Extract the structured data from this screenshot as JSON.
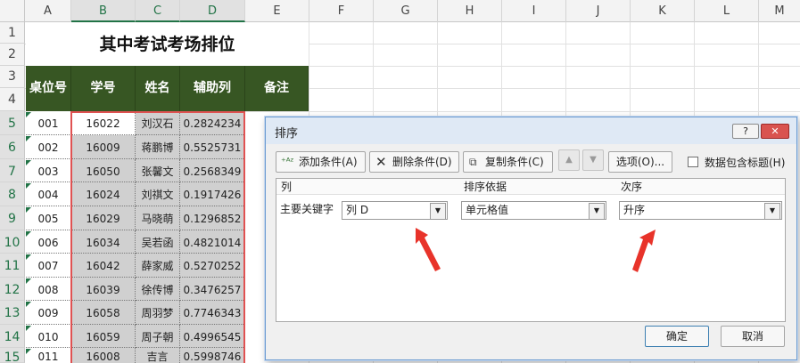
{
  "columns": [
    "A",
    "B",
    "C",
    "D",
    "E",
    "F",
    "G",
    "H",
    "I",
    "J",
    "K",
    "L",
    "M"
  ],
  "rows": [
    "1",
    "2",
    "3",
    "4",
    "5",
    "6",
    "7",
    "8",
    "9",
    "10",
    "11",
    "12",
    "13",
    "14",
    "15"
  ],
  "sheet": {
    "title": "其中考试考场排位",
    "headers": [
      "桌位号",
      "学号",
      "姓名",
      "辅助列",
      "备注"
    ],
    "data_rows": [
      {
        "seat": "001",
        "id": "16022",
        "name": "刘汉石",
        "aux": "0.2824234"
      },
      {
        "seat": "002",
        "id": "16009",
        "name": "蒋鹏博",
        "aux": "0.5525731"
      },
      {
        "seat": "003",
        "id": "16050",
        "name": "张馨文",
        "aux": "0.2568349"
      },
      {
        "seat": "004",
        "id": "16024",
        "name": "刘祺文",
        "aux": "0.1917426"
      },
      {
        "seat": "005",
        "id": "16029",
        "name": "马晓萌",
        "aux": "0.1296852"
      },
      {
        "seat": "006",
        "id": "16034",
        "name": "吴若函",
        "aux": "0.4821014"
      },
      {
        "seat": "007",
        "id": "16042",
        "name": "薛家威",
        "aux": "0.5270252"
      },
      {
        "seat": "008",
        "id": "16039",
        "name": "徐传博",
        "aux": "0.3476257"
      },
      {
        "seat": "009",
        "id": "16058",
        "name": "周羽梦",
        "aux": "0.7746343"
      },
      {
        "seat": "010",
        "id": "16059",
        "name": "周子朝",
        "aux": "0.4996545"
      },
      {
        "seat": "011",
        "id": "16008",
        "name": "吉言",
        "aux": "0.5998746"
      }
    ]
  },
  "dialog": {
    "title": "排序",
    "help_label": "?",
    "close_label": "✕",
    "add_condition": "添加条件(A)",
    "delete_condition": "删除条件(D)",
    "copy_condition": "复制条件(C)",
    "options": "选项(O)...",
    "header_checkbox_label": "数据包含标题(H)",
    "col_header": "列",
    "sort_on_header": "排序依据",
    "order_header": "次序",
    "primary_key_label": "主要关键字",
    "column_value": "列 D",
    "sort_on_value": "单元格值",
    "order_value": "升序",
    "ok": "确定",
    "cancel": "取消"
  },
  "colors": {
    "header_green": "#375623",
    "selection_red": "#e05252",
    "annotation_arrow_red": "#e8332a"
  }
}
